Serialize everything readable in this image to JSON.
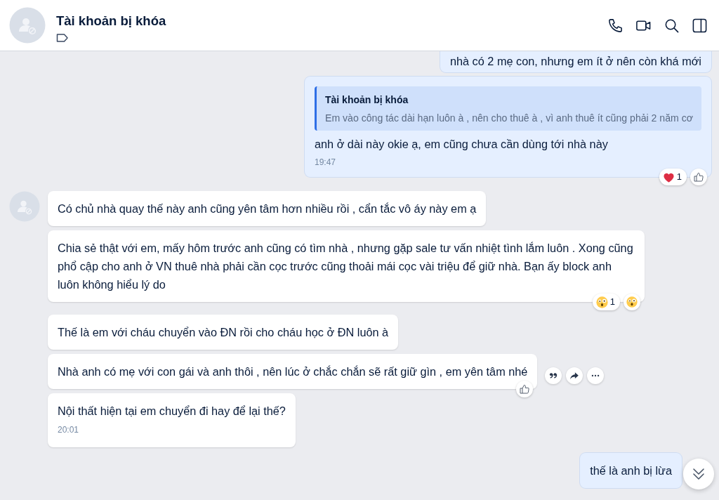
{
  "header": {
    "title": "Tài khoản bị khóa",
    "actions": [
      {
        "kind": "call"
      },
      {
        "kind": "video"
      },
      {
        "kind": "search"
      },
      {
        "kind": "panel"
      }
    ]
  },
  "groups": [
    {
      "kind": "sent",
      "messages": [
        {
          "text": "nhà có 2 mẹ con, nhưng em ít ở nên còn khá mới"
        },
        {
          "quote": {
            "author": "Tài khoản bị khóa",
            "text": "Em vào công tác dài hạn luôn à , nên cho thuê à , vì anh thuê ít cũng phải 2 năm cơ"
          },
          "text": "anh ở dài này okie ạ, em cũng chưa cần dùng tới nhà này",
          "time": "19:47",
          "reactions": [
            {
              "kind": "heart",
              "count": "1"
            },
            {
              "kind": "like"
            }
          ]
        }
      ]
    },
    {
      "kind": "received",
      "messages": [
        {
          "text": "Có chủ nhà quay thế này anh cũng yên tâm hơn nhiều rồi , cẩn tắc vô áy này em ạ"
        },
        {
          "text": "Chia sẻ thật với em, mấy hôm trước anh cũng có tìm nhà , nhưng gặp sale tư vấn nhiệt tình lắm luôn . Xong cũng phổ cập cho anh ở VN thuê nhà phải cần cọc trước cũng thoải mái cọc vài triệu để giữ nhà. Bạn ấy block anh luôn không hiểu lý do",
          "reactions": [
            {
              "kind": "surprised",
              "count": "1"
            },
            {
              "kind": "surprised"
            }
          ]
        },
        {
          "text": "Thế là em với cháu chuyển vào ĐN rồi cho cháu học ở ĐN luôn à"
        },
        {
          "text": "Nhà anh có mẹ với con gái và anh thôi , nên lúc ở chắc chắn sẽ rất giữ gìn , em yên tâm nhé",
          "actions": [
            {
              "kind": "quote"
            },
            {
              "kind": "share"
            },
            {
              "kind": "more"
            }
          ],
          "reactions": [
            {
              "kind": "like"
            }
          ]
        },
        {
          "text": "Nội thất hiện tại em chuyển đi hay để lại thế?",
          "time": "20:01"
        }
      ]
    },
    {
      "kind": "sent",
      "messages": [
        {
          "text": "thế là anh bị lừa"
        }
      ]
    }
  ]
}
